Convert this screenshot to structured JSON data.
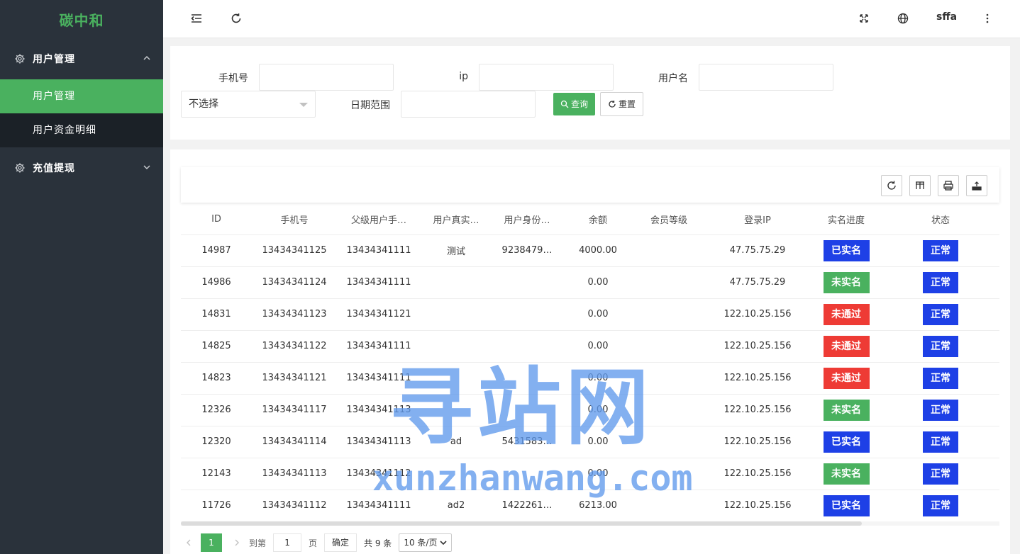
{
  "app": {
    "logo": "碳中和"
  },
  "sidebar": {
    "groups": [
      {
        "label": "用户管理",
        "icon": "gear-icon",
        "expanded": true,
        "items": [
          {
            "label": "用户管理",
            "active": true
          },
          {
            "label": "用户资金明细",
            "active": false
          }
        ]
      },
      {
        "label": "充值提现",
        "icon": "gear-icon",
        "expanded": false,
        "items": []
      }
    ]
  },
  "header": {
    "icons": [
      "menu-collapse-icon",
      "refresh-icon",
      "fullscreen-icon",
      "globe-icon",
      "more-vertical-icon"
    ],
    "username": "sffa"
  },
  "search": {
    "phone_label": "手机号",
    "phone_value": "",
    "ip_label": "ip",
    "ip_value": "",
    "username_label": "用户名",
    "username_value": "",
    "select_value": "不选择",
    "date_label": "日期范围",
    "date_value": "",
    "query_button": "查询",
    "reset_button": "重置"
  },
  "table": {
    "toolbar_icons": [
      "refresh-icon",
      "columns-icon",
      "print-icon",
      "export-icon"
    ],
    "columns": [
      "ID",
      "手机号",
      "父级用户手…",
      "用户真实…",
      "用户身份…",
      "余额",
      "会员等级",
      "登录IP",
      "实名进度",
      "状态"
    ],
    "rows": [
      {
        "id": "14987",
        "phone": "13434341125",
        "parent": "13434341111",
        "real": "测试",
        "idcard": "9238479…",
        "balance": "4000.00",
        "level": "",
        "ip": "47.75.75.29",
        "verify": "已实名",
        "verify_color": "#1e40e6",
        "status": "正常"
      },
      {
        "id": "14986",
        "phone": "13434341124",
        "parent": "13434341111",
        "real": "",
        "idcard": "",
        "balance": "0.00",
        "level": "",
        "ip": "47.75.75.29",
        "verify": "未实名",
        "verify_color": "#4ab15f",
        "status": "正常"
      },
      {
        "id": "14831",
        "phone": "13434341123",
        "parent": "13434341121",
        "real": "",
        "idcard": "",
        "balance": "0.00",
        "level": "",
        "ip": "122.10.25.156",
        "verify": "未通过",
        "verify_color": "#ee3b35",
        "status": "正常"
      },
      {
        "id": "14825",
        "phone": "13434341122",
        "parent": "13434341111",
        "real": "",
        "idcard": "",
        "balance": "0.00",
        "level": "",
        "ip": "122.10.25.156",
        "verify": "未通过",
        "verify_color": "#ee3b35",
        "status": "正常"
      },
      {
        "id": "14823",
        "phone": "13434341121",
        "parent": "13434341111",
        "real": "",
        "idcard": "",
        "balance": "0.00",
        "level": "",
        "ip": "122.10.25.156",
        "verify": "未通过",
        "verify_color": "#ee3b35",
        "status": "正常"
      },
      {
        "id": "12326",
        "phone": "13434341117",
        "parent": "13434341113",
        "real": "",
        "idcard": "",
        "balance": "0.00",
        "level": "",
        "ip": "122.10.25.156",
        "verify": "未实名",
        "verify_color": "#4ab15f",
        "status": "正常"
      },
      {
        "id": "12320",
        "phone": "13434341114",
        "parent": "13434341113",
        "real": "ad",
        "idcard": "5431583…",
        "balance": "0.00",
        "level": "",
        "ip": "122.10.25.156",
        "verify": "已实名",
        "verify_color": "#1e40e6",
        "status": "正常"
      },
      {
        "id": "12143",
        "phone": "13434341113",
        "parent": "13434341112",
        "real": "",
        "idcard": "",
        "balance": "0.00",
        "level": "",
        "ip": "122.10.25.156",
        "verify": "未实名",
        "verify_color": "#4ab15f",
        "status": "正常"
      },
      {
        "id": "11726",
        "phone": "13434341112",
        "parent": "13434341111",
        "real": "ad2",
        "idcard": "1422261…",
        "balance": "6213.00",
        "level": "",
        "ip": "122.10.25.156",
        "verify": "已实名",
        "verify_color": "#1e40e6",
        "status": "正常"
      }
    ],
    "status_color": "#1e40e6"
  },
  "pager": {
    "current_page": "1",
    "goto_label": "到第",
    "goto_value": "1",
    "page_unit": "页",
    "ok_button": "确定",
    "total": "共 9 条",
    "page_size": "10 条/页"
  },
  "watermark": {
    "main": "寻站网",
    "sub": "xunzhanwang.com"
  }
}
